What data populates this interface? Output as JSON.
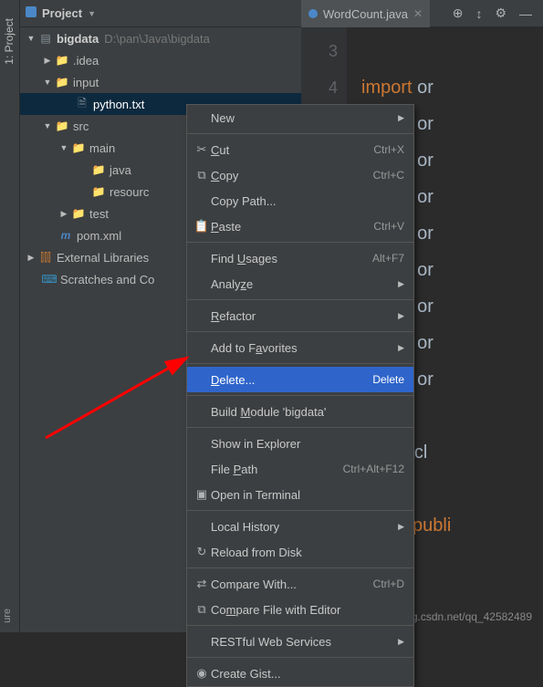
{
  "vtab": {
    "label": "1: Project"
  },
  "toolbar": {
    "title": "Project"
  },
  "editorTab": {
    "label": "WordCount.java"
  },
  "tree": {
    "root": {
      "label": "bigdata",
      "path": "D:\\pan\\Java\\bigdata"
    },
    "idea": ".idea",
    "input": "input",
    "python": "python.txt",
    "src": "src",
    "main": "main",
    "java": "java",
    "resources": "resourc",
    "test": "test",
    "pom": "pom.xml",
    "extLib": "External Libraries",
    "scratch": "Scratches and Co"
  },
  "gutter": {
    "l1": "3",
    "l2": "4"
  },
  "code": {
    "import": "import",
    "org": "or",
    "pub": "public",
    "cl": "cl",
    "publ": "publi"
  },
  "menu": {
    "new": "New",
    "cut": "Cut",
    "cutKey": "Ctrl+X",
    "copy": "Copy",
    "copyKey": "Ctrl+C",
    "copyPath": "Copy Path...",
    "paste": "Paste",
    "pasteKey": "Ctrl+V",
    "findUsages": "Find Usages",
    "findUsagesKey": "Alt+F7",
    "analyze": "Analyze",
    "refactor": "Refactor",
    "addFav": "Add to Favorites",
    "delete": "Delete...",
    "deleteKey": "Delete",
    "buildModule": "Build Module 'bigdata'",
    "showExplorer": "Show in Explorer",
    "filePath": "File Path",
    "filePathKey": "Ctrl+Alt+F12",
    "openTerminal": "Open in Terminal",
    "localHistory": "Local History",
    "reload": "Reload from Disk",
    "compareWith": "Compare With...",
    "compareKey": "Ctrl+D",
    "compareFile": "Compare File with Editor",
    "restful": "RESTful Web Services",
    "createGist": "Create Gist..."
  },
  "watermark": "https://blog.csdn.net/qq_42582489",
  "bottomLabel": "ure"
}
